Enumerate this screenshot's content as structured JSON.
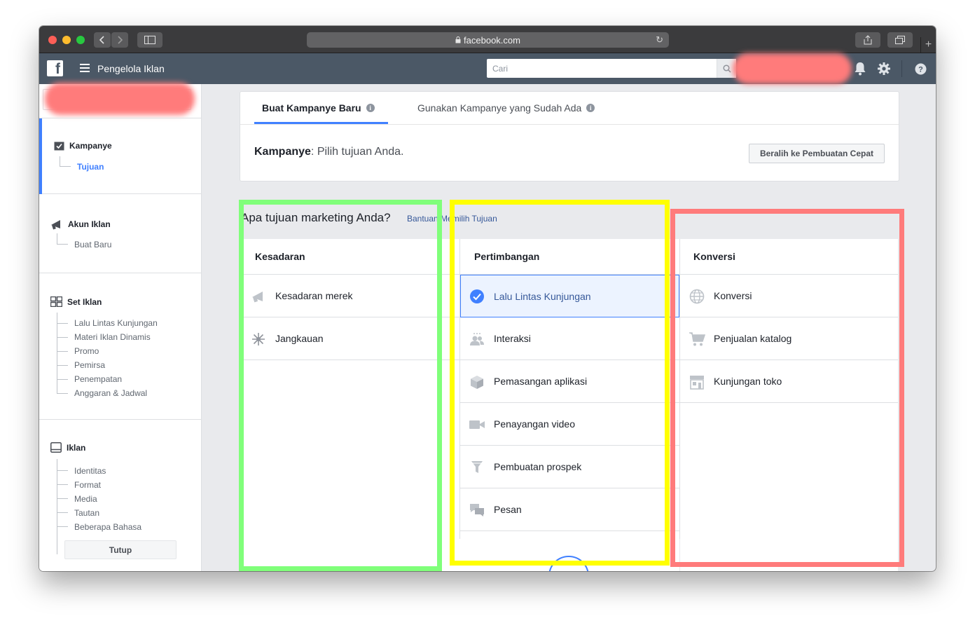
{
  "browser": {
    "url": "facebook.com",
    "traffic_light_colors": [
      "#fe5f57",
      "#febc2e",
      "#28c840"
    ]
  },
  "header": {
    "app_title": "Pengelola Iklan",
    "search_placeholder": "Cari"
  },
  "sidebar": {
    "campaign": {
      "label": "Kampanye",
      "sub": "Tujuan"
    },
    "ad_account": {
      "label": "Akun Iklan",
      "sub": "Buat Baru"
    },
    "ad_set": {
      "label": "Set Iklan",
      "items": [
        "Lalu Lintas Kunjungan",
        "Materi Iklan Dinamis",
        "Promo",
        "Pemirsa",
        "Penempatan",
        "Anggaran & Jadwal"
      ]
    },
    "ad": {
      "label": "Iklan",
      "items": [
        "Identitas",
        "Format",
        "Media",
        "Tautan",
        "Beberapa Bahasa"
      ]
    },
    "close_label": "Tutup"
  },
  "campaign_card": {
    "tabs": [
      "Buat Kampanye Baru",
      "Gunakan Kampanye yang Sudah Ada"
    ],
    "label_bold": "Kampanye",
    "label_rest": ": Pilih tujuan Anda.",
    "quick_button": "Beralih ke Pembuatan Cepat"
  },
  "objectives": {
    "question": "Apa tujuan marketing Anda?",
    "help_link": "Bantuan Memilih Tujuan",
    "columns": [
      {
        "title": "Kesadaran",
        "items": [
          {
            "label": "Kesadaran merek",
            "icon": "megaphone-icon"
          },
          {
            "label": "Jangkauan",
            "icon": "reach-icon"
          }
        ]
      },
      {
        "title": "Pertimbangan",
        "items": [
          {
            "label": "Lalu Lintas Kunjungan",
            "icon": "check-circle-icon",
            "selected": true
          },
          {
            "label": "Interaksi",
            "icon": "people-icon"
          },
          {
            "label": "Pemasangan aplikasi",
            "icon": "cube-icon"
          },
          {
            "label": "Penayangan video",
            "icon": "video-camera-icon"
          },
          {
            "label": "Pembuatan prospek",
            "icon": "funnel-icon"
          },
          {
            "label": "Pesan",
            "icon": "chat-bubbles-icon"
          }
        ]
      },
      {
        "title": "Konversi",
        "items": [
          {
            "label": "Konversi",
            "icon": "globe-icon"
          },
          {
            "label": "Penjualan katalog",
            "icon": "cart-icon"
          },
          {
            "label": "Kunjungan toko",
            "icon": "store-icon"
          }
        ]
      }
    ]
  },
  "highlight_colors": {
    "awareness": "#80ff7a",
    "consideration": "#ffff00",
    "conversion": "#ff7b7b",
    "redaction": "#ff7b7b"
  }
}
